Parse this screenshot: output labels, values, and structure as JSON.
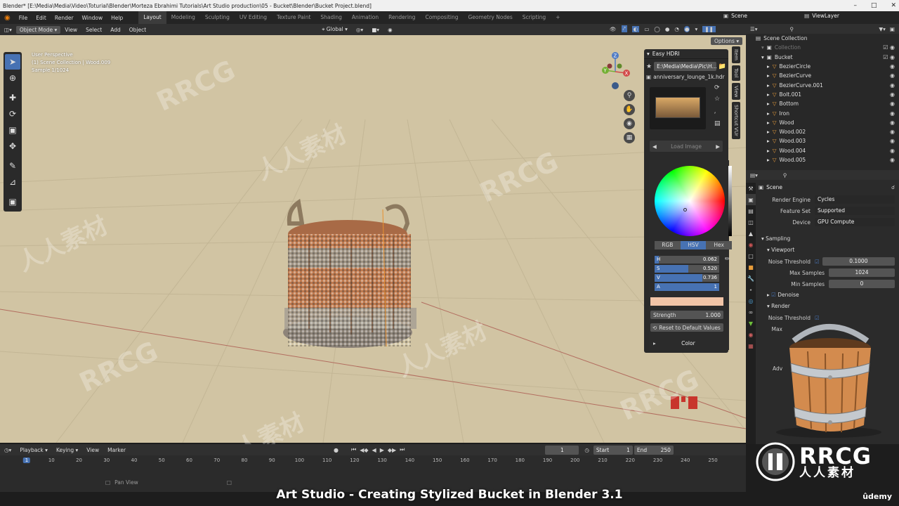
{
  "title_bar": {
    "text": "Blender* [E:\\Media\\Media\\Video\\Toturial\\Blender\\Morteza Ebrahimi Tutorials\\Art Studio production\\05 - Bucket\\Blender\\Bucket Project.blend]"
  },
  "menu": {
    "items": [
      "File",
      "Edit",
      "Render",
      "Window",
      "Help"
    ],
    "workspaces": [
      "Layout",
      "Modeling",
      "Sculpting",
      "UV Editing",
      "Texture Paint",
      "Shading",
      "Animation",
      "Rendering",
      "Compositing",
      "Geometry Nodes",
      "Scripting"
    ],
    "add_tab": "+",
    "scene": "Scene",
    "view_layer": "ViewLayer"
  },
  "viewport_header": {
    "mode": "Object Mode",
    "menus": [
      "View",
      "Select",
      "Add",
      "Object"
    ],
    "orientation": "Global",
    "options": "Options"
  },
  "viewport": {
    "overlay_lines": [
      "User Perspective",
      "(1) Scene Collection | Wood.009",
      "Sample 1/1024"
    ],
    "axis": {
      "x": "X",
      "y": "Y",
      "z": "Z"
    },
    "side_tabs": [
      "Item",
      "Tool",
      "View",
      "Shortcut VUr"
    ]
  },
  "easy_hdri": {
    "title": "Easy HDRI",
    "path": "E:\\Media\\Media\\Pic\\H...",
    "file": "anniversary_lounge_1k.hdr",
    "load_image": "Load Image",
    "color_tabs": [
      "RGB",
      "HSV",
      "Hex"
    ],
    "hsva": [
      {
        "label": "H",
        "value": "0.062",
        "fraction": 0.062
      },
      {
        "label": "S",
        "value": "0.520",
        "fraction": 0.52
      },
      {
        "label": "V",
        "value": "0.736",
        "fraction": 0.736
      },
      {
        "label": "A",
        "value": "1",
        "fraction": 1.0
      }
    ],
    "swatch_color": "#f1c4a7",
    "strength_label": "Strength",
    "strength_value": "1.000",
    "reset_label": "Reset to Default Values",
    "color_label": "Color"
  },
  "outliner": {
    "root": "Scene Collection",
    "items": [
      {
        "name": "Collection",
        "depth": 1,
        "dim": true
      },
      {
        "name": "Bucket",
        "depth": 1
      },
      {
        "name": "BezierCircle",
        "depth": 2
      },
      {
        "name": "BezierCurve",
        "depth": 2
      },
      {
        "name": "BezierCurve.001",
        "depth": 2
      },
      {
        "name": "Bolt.001",
        "depth": 2
      },
      {
        "name": "Bottom",
        "depth": 2
      },
      {
        "name": "Iron",
        "depth": 2
      },
      {
        "name": "Wood",
        "depth": 2
      },
      {
        "name": "Wood.002",
        "depth": 2
      },
      {
        "name": "Wood.003",
        "depth": 2
      },
      {
        "name": "Wood.004",
        "depth": 2
      },
      {
        "name": "Wood.005",
        "depth": 2
      }
    ]
  },
  "properties": {
    "scene_label": "Scene",
    "render_engine_label": "Render Engine",
    "render_engine": "Cycles",
    "feature_set_label": "Feature Set",
    "feature_set": "Supported",
    "device_label": "Device",
    "device": "GPU Compute",
    "sampling": "Sampling",
    "viewport": "Viewport",
    "noise_threshold_label": "Noise Threshold",
    "noise_threshold": "0.1000",
    "max_samples_label": "Max Samples",
    "max_samples": "1024",
    "min_samples_label": "Min Samples",
    "min_samples": "0",
    "denoise": "Denoise",
    "render": "Render",
    "render_noise_threshold_label": "Noise Threshold",
    "render_max_label": "Max",
    "adv_label": "Adv"
  },
  "timeline": {
    "menus": [
      "Playback",
      "Keying",
      "View",
      "Marker"
    ],
    "current_frame": "1",
    "start_label": "Start",
    "start": "1",
    "end_label": "End",
    "end": "250",
    "ticks": [
      "1",
      "10",
      "20",
      "30",
      "40",
      "50",
      "60",
      "70",
      "80",
      "90",
      "100",
      "110",
      "120",
      "130",
      "140",
      "150",
      "160",
      "170",
      "180",
      "190",
      "200",
      "210",
      "220",
      "230",
      "240",
      "250"
    ],
    "status": "Pan View"
  },
  "caption": "Art Studio - Creating Stylized Bucket in Blender 3.1",
  "brand": "ûdemy",
  "watermarks": [
    "RRCG",
    "人人素材"
  ],
  "logo_text": {
    "main": "RRCG",
    "sub": "人人素材"
  }
}
